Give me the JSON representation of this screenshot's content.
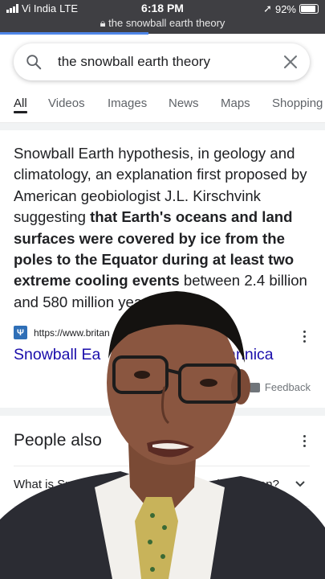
{
  "status_bar": {
    "carrier": "Vi India",
    "network": "LTE",
    "time": "6:18 PM",
    "battery": "92%",
    "battery_level": 0.92,
    "url": "the snowball earth theory"
  },
  "search": {
    "query": "the snowball earth theory"
  },
  "tabs": [
    "All",
    "Videos",
    "Images",
    "News",
    "Maps",
    "Shopping"
  ],
  "snippet": {
    "lead": "Snowball Earth hypothesis, in geology and climatology, an explanation first proposed by American geobiologist J.L. Kirschvink suggesting ",
    "bold": "that Earth's oceans and land surfaces were covered by ice from the poles to the Equator during at least two extreme cooling events",
    "tail": " between 2.4 billion and 580 milli",
    "tail_end": "on years ago."
  },
  "result": {
    "source_url": "https://www.britan",
    "title": "Snowball Ea",
    "title_end": "itannica",
    "feedback": "Feedback"
  },
  "paa": {
    "title": "People also",
    "questions": [
      {
        "text": "What is Snowba",
        "text_end": "d it happen?"
      },
      {
        "text": "",
        "text_end": ""
      }
    ]
  },
  "colors": {
    "status_bg": "#3f3f43",
    "link": "#1a0dab",
    "accent": "#4f86e8"
  }
}
